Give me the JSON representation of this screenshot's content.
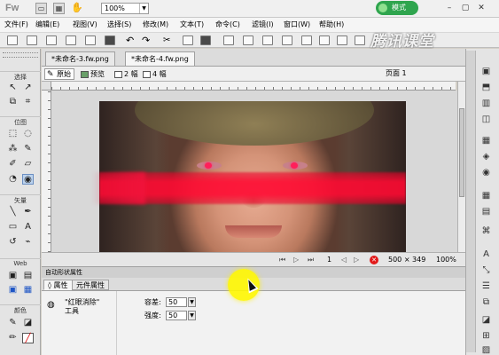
{
  "titlebar": {
    "app_logo": "Fw",
    "icons": [
      "doc-icon",
      "bridge-icon",
      "hand-icon"
    ],
    "zoom": "100%",
    "mode": "模式"
  },
  "watermark": "腾讯课堂",
  "menu": [
    "文件(F)",
    "编辑(E)",
    "视图(V)",
    "选择(S)",
    "修改(M)",
    "文本(T)",
    "命令(C)",
    "滤镜(I)",
    "窗口(W)",
    "帮助(H)"
  ],
  "documents": {
    "tabs": [
      "*未命名-3.fw.png",
      "*未命名-4.fw.png"
    ],
    "active_index": 1
  },
  "view_tabs": [
    {
      "label": "原始",
      "icon": "pencil-icon"
    },
    {
      "label": "预览",
      "icon": "preview-icon"
    },
    {
      "label": "2 幅",
      "icon": "2up-icon"
    },
    {
      "label": "4 幅",
      "icon": "4up-icon"
    }
  ],
  "page_selector": "页面 1",
  "tools_panel": {
    "sections": [
      "选择",
      "位图",
      "矢量",
      "Web",
      "颜色"
    ]
  },
  "status": {
    "frame": "1",
    "size": "500 × 349",
    "zoom": "100%"
  },
  "properties": {
    "header": "自动形状属性",
    "tabs": [
      "◊ 属性",
      "元件属性"
    ],
    "tool_name": "\"红眼消除\"",
    "tool_type": "工具",
    "fields": [
      {
        "label": "容差:",
        "value": "50"
      },
      {
        "label": "强度:",
        "value": "50"
      }
    ]
  },
  "colors": {
    "accent_green": "#2fa54e",
    "red_eye": "#ff1f5a",
    "highlight_yellow": "#fff700"
  }
}
